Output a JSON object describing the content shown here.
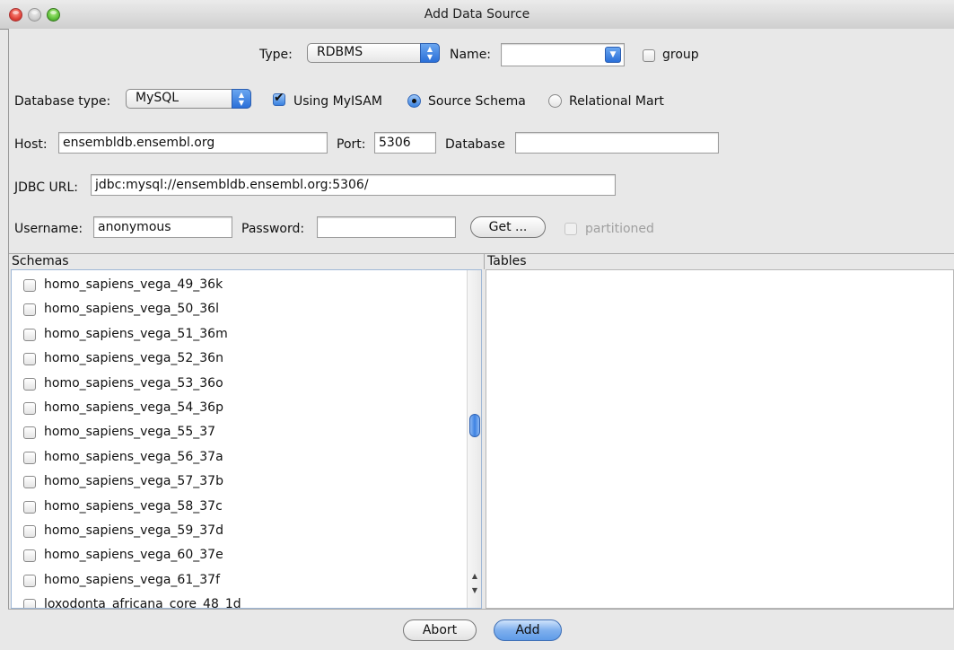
{
  "window": {
    "title": "Add Data Source"
  },
  "row1": {
    "type_label": "Type:",
    "type_value": "RDBMS",
    "name_label": "Name:",
    "name_value": "",
    "group_label": "group"
  },
  "row2": {
    "dbtype_label": "Database type:",
    "dbtype_value": "MySQL",
    "myisam_label": "Using MyISAM",
    "source_schema_label": "Source Schema",
    "relational_mart_label": "Relational Mart"
  },
  "row3": {
    "host_label": "Host:",
    "host_value": "ensembldb.ensembl.org",
    "port_label": "Port:",
    "port_value": "5306",
    "database_label": "Database",
    "database_value": ""
  },
  "row4": {
    "jdbc_label": "JDBC URL:",
    "jdbc_value": "jdbc:mysql://ensembldb.ensembl.org:5306/"
  },
  "row5": {
    "username_label": "Username:",
    "username_value": "anonymous",
    "password_label": "Password:",
    "password_value": "",
    "get_label": "Get ...",
    "partitioned_label": "partitioned"
  },
  "schemas": {
    "header": "Schemas",
    "items": [
      "homo_sapiens_vega_49_36k",
      "homo_sapiens_vega_50_36l",
      "homo_sapiens_vega_51_36m",
      "homo_sapiens_vega_52_36n",
      "homo_sapiens_vega_53_36o",
      "homo_sapiens_vega_54_36p",
      "homo_sapiens_vega_55_37",
      "homo_sapiens_vega_56_37a",
      "homo_sapiens_vega_57_37b",
      "homo_sapiens_vega_58_37c",
      "homo_sapiens_vega_59_37d",
      "homo_sapiens_vega_60_37e",
      "homo_sapiens_vega_61_37f",
      "loxodonta_africana_core_48_1d"
    ]
  },
  "tables": {
    "header": "Tables"
  },
  "buttons": {
    "abort": "Abort",
    "add": "Add"
  },
  "colors": {
    "accent": "#3a82e0",
    "window_bg": "#e8e8e8"
  }
}
